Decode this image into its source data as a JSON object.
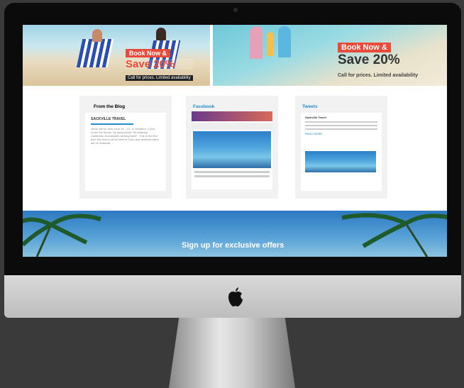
{
  "promo_left": {
    "book": "Book Now &",
    "save": "Save 20%",
    "call": "Call for prices. Limited availability"
  },
  "promo_right": {
    "book": "Book Now &",
    "save": "Save 20%",
    "call": "Call for prices. Limited availability"
  },
  "blog": {
    "title": "From the Blog",
    "post_title": "SACKVILLE TRAVEL",
    "body": "which will be held June 19 – 21, in Varadero, Cuba, under the theme \"by symposium: Re-shaping Caribbean Sustainable development\". This is the first time this event will be held in Cuba and whereas there are no financial ..."
  },
  "facebook": {
    "title": "Facebook"
  },
  "tweets": {
    "title": "Tweets",
    "author": "Sackville Travel",
    "more": "READ MORE"
  },
  "signup": {
    "label": "Sign up for exclusive offers"
  },
  "colors": {
    "accent": "#e84a3b",
    "link": "#2a8ac8"
  }
}
